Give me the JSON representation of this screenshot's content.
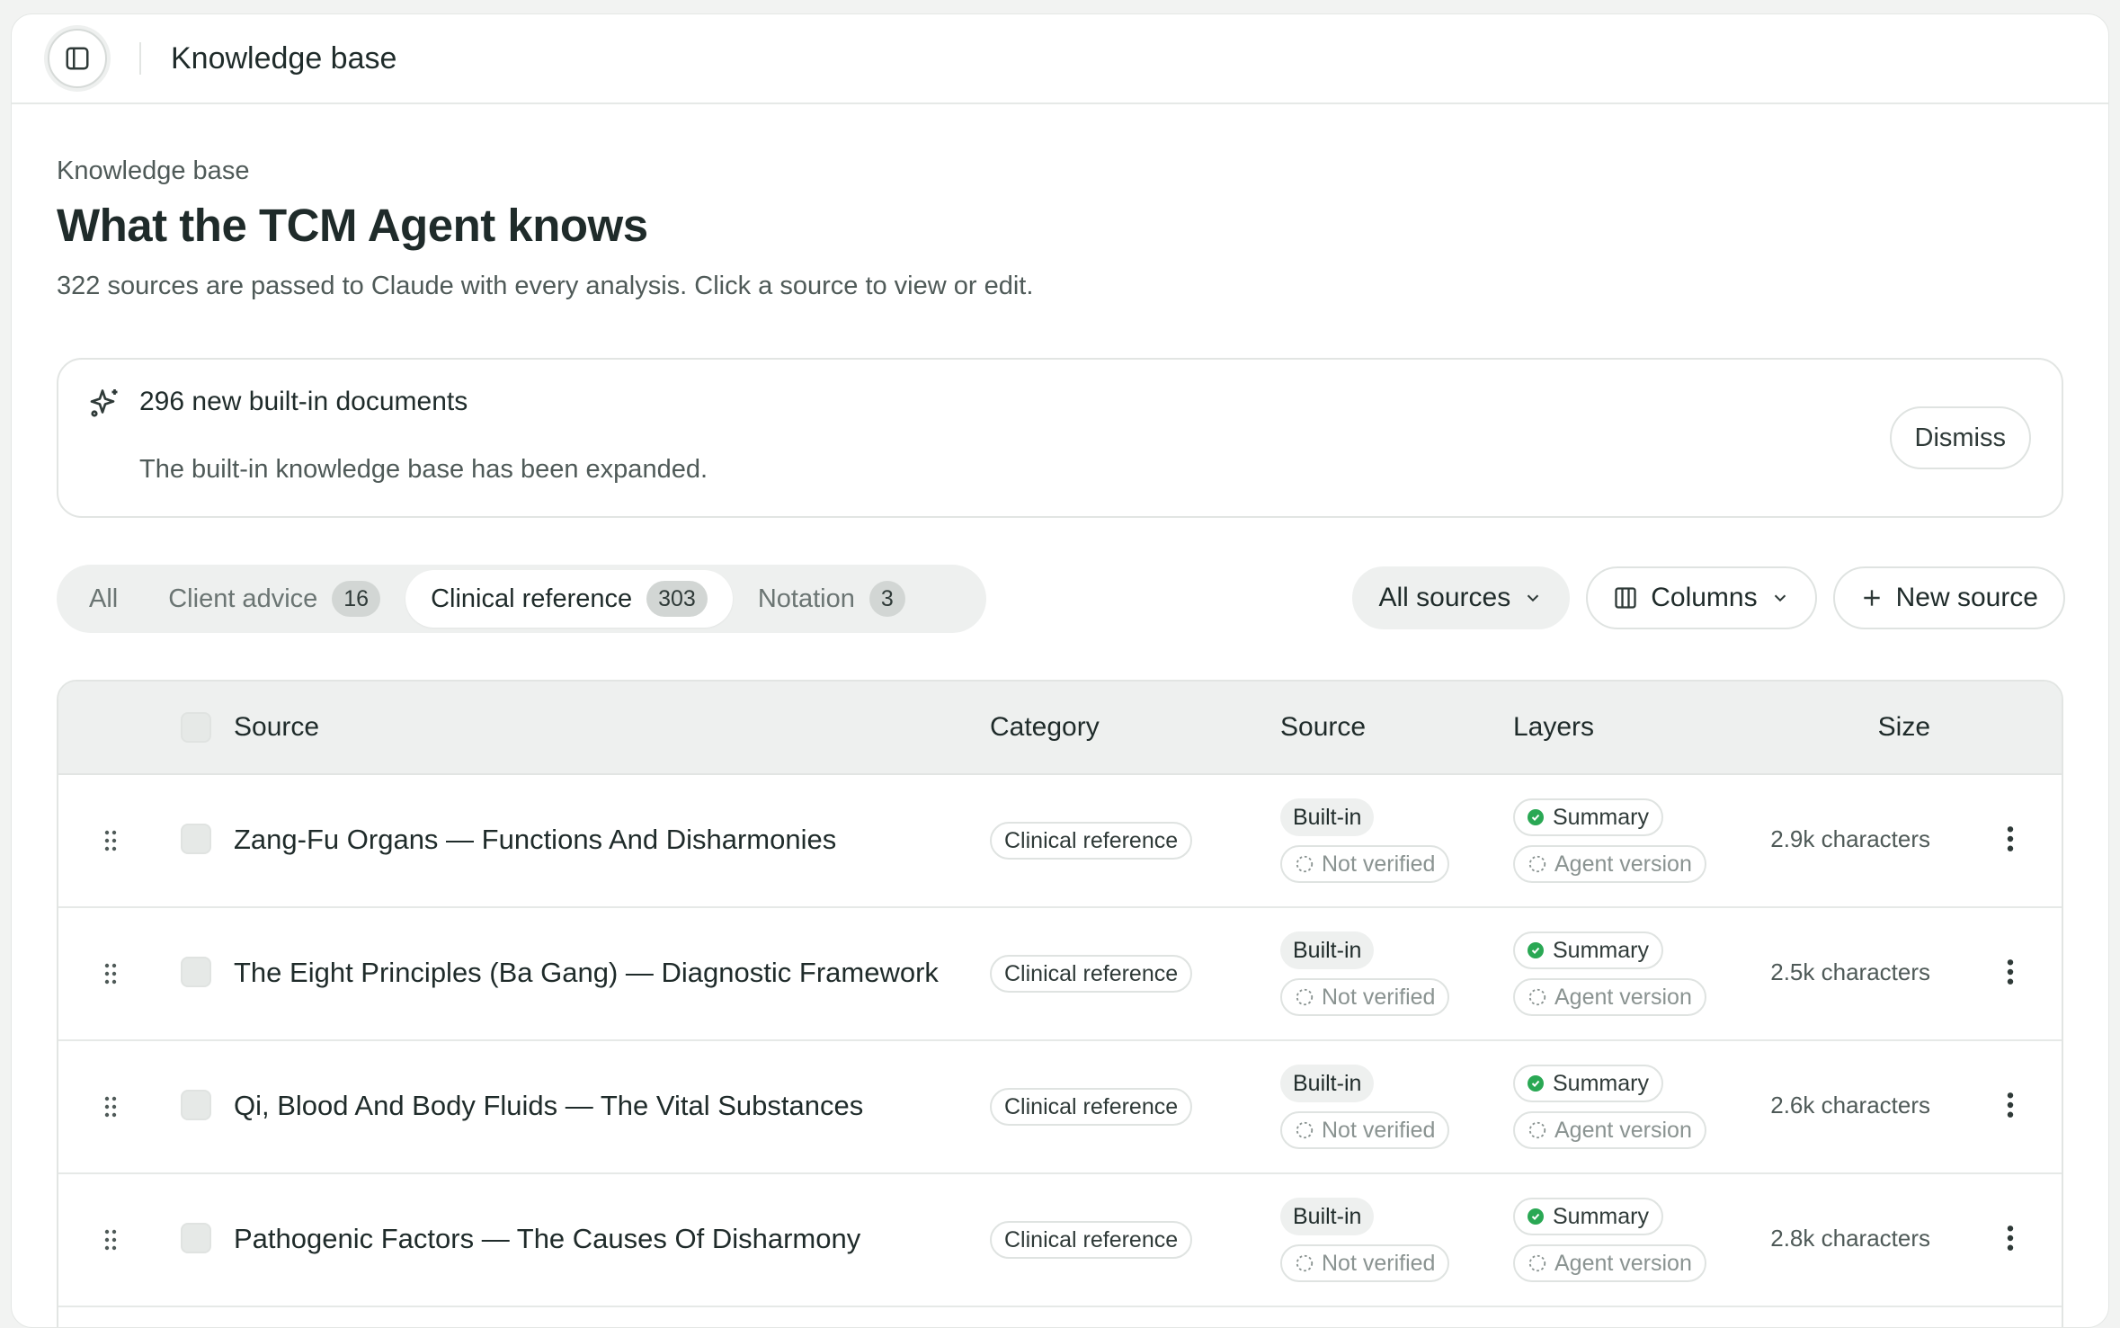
{
  "topbar": {
    "title": "Knowledge base"
  },
  "header": {
    "eyebrow": "Knowledge base",
    "title": "What the TCM Agent knows",
    "subtitle": "322 sources are passed to Claude with every analysis. Click a source to view or edit."
  },
  "banner": {
    "title": "296 new built-in documents",
    "text": "The built-in knowledge base has been expanded.",
    "dismiss_label": "Dismiss"
  },
  "tabs": [
    {
      "label": "All",
      "count": null
    },
    {
      "label": "Client advice",
      "count": "16"
    },
    {
      "label": "Clinical reference",
      "count": "303",
      "active": true
    },
    {
      "label": "Notation",
      "count": "3"
    }
  ],
  "toolbar": {
    "filter_label": "All sources",
    "columns_label": "Columns",
    "new_label": "New source"
  },
  "table": {
    "headers": {
      "source": "Source",
      "category": "Category",
      "origin": "Source",
      "layers": "Layers",
      "size": "Size"
    },
    "rows": [
      {
        "title": "Zang-Fu Organs — Functions And Disharmonies",
        "category": "Clinical reference",
        "origin": "Built-in",
        "verification": "Not verified",
        "layer_summary": "Summary",
        "layer_agent": "Agent version",
        "size": "2.9k characters"
      },
      {
        "title": "The Eight Principles (Ba Gang) — Diagnostic Framework",
        "category": "Clinical reference",
        "origin": "Built-in",
        "verification": "Not verified",
        "layer_summary": "Summary",
        "layer_agent": "Agent version",
        "size": "2.5k characters"
      },
      {
        "title": "Qi, Blood And Body Fluids — The Vital Substances",
        "category": "Clinical reference",
        "origin": "Built-in",
        "verification": "Not verified",
        "layer_summary": "Summary",
        "layer_agent": "Agent version",
        "size": "2.6k characters"
      },
      {
        "title": "Pathogenic Factors — The Causes Of Disharmony",
        "category": "Clinical reference",
        "origin": "Built-in",
        "verification": "Not verified",
        "layer_summary": "Summary",
        "layer_agent": "Agent version",
        "size": "2.8k characters"
      }
    ]
  },
  "colors": {
    "accent_green": "#2aa854",
    "text": "#1f2b2a",
    "muted": "#4f5a58"
  }
}
